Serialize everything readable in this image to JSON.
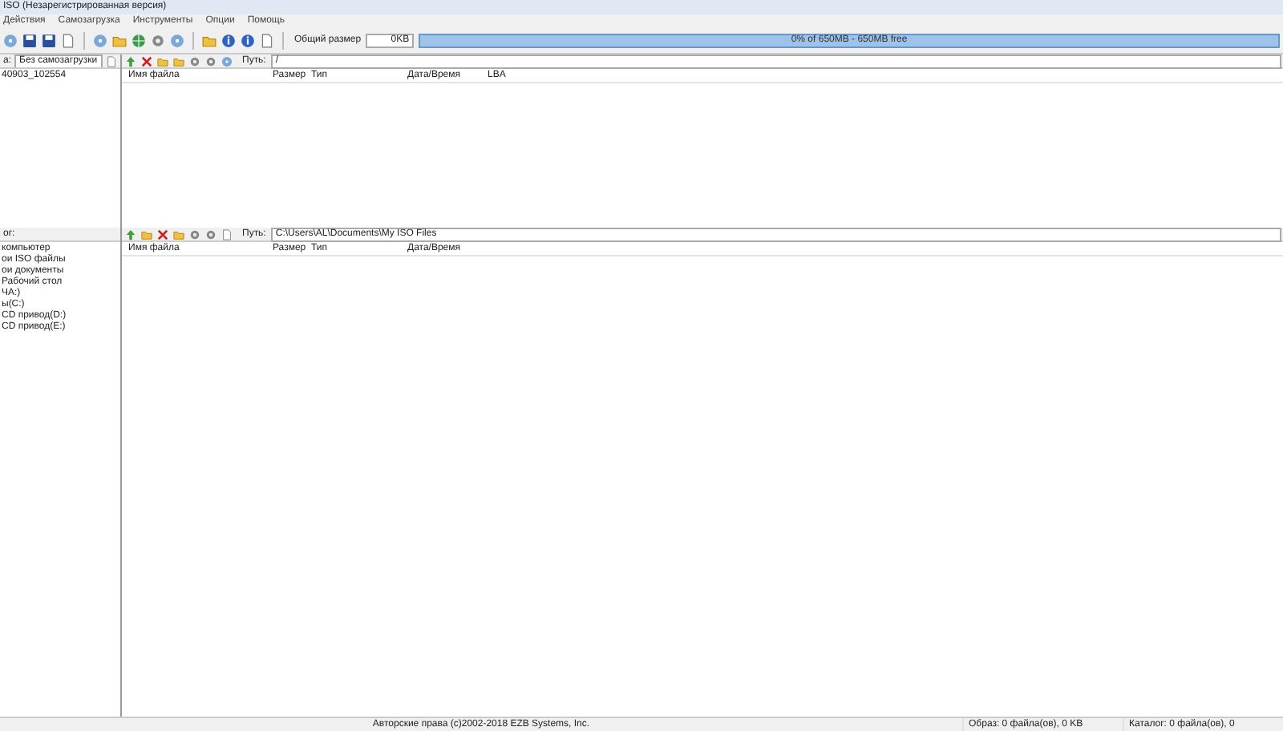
{
  "window": {
    "title": "ISO (Незарегистрированная версия)"
  },
  "menu": [
    "Действия",
    "Самозагрузка",
    "Инструменты",
    "Опции",
    "Помощь"
  ],
  "toolbar": {
    "total_size_label": "Общий размер",
    "total_size_value": "0KB",
    "capacity": {
      "level": 0,
      "reading": "0% of 650MB - 650MB free"
    }
  },
  "image_pane": {
    "boot_label": "а:",
    "boot_value": "Без самозагрузки",
    "path_label": "Путь:",
    "path_value": "/",
    "tree": [
      {
        "label": "40903_102554"
      }
    ],
    "columns": [
      "Имя файла",
      "Размер",
      "Тип",
      "Дата/Время",
      "LBA"
    ]
  },
  "local_pane": {
    "tree_label": "ог:",
    "path_label": "Путь:",
    "path_value": "C:\\Users\\AL\\Documents\\My ISO Files",
    "tree": [
      {
        "label": "компьютер"
      },
      {
        "label": "ои ISO файлы"
      },
      {
        "label": "ои документы"
      },
      {
        "label": "Рабочий стол"
      },
      {
        "label": "ЧА:)"
      },
      {
        "label": "ы(C:)"
      },
      {
        "label": "CD привод(D:)"
      },
      {
        "label": "CD привод(E:)"
      }
    ],
    "columns": [
      "Имя файла",
      "Размер",
      "Тип",
      "Дата/Время"
    ]
  },
  "status_bar": [
    "Авторские права (c)2002-2018 EZB Systems, Inc.",
    "Образ: 0 файла(ов), 0 KB",
    "Каталог: 0 файла(ов), 0"
  ]
}
